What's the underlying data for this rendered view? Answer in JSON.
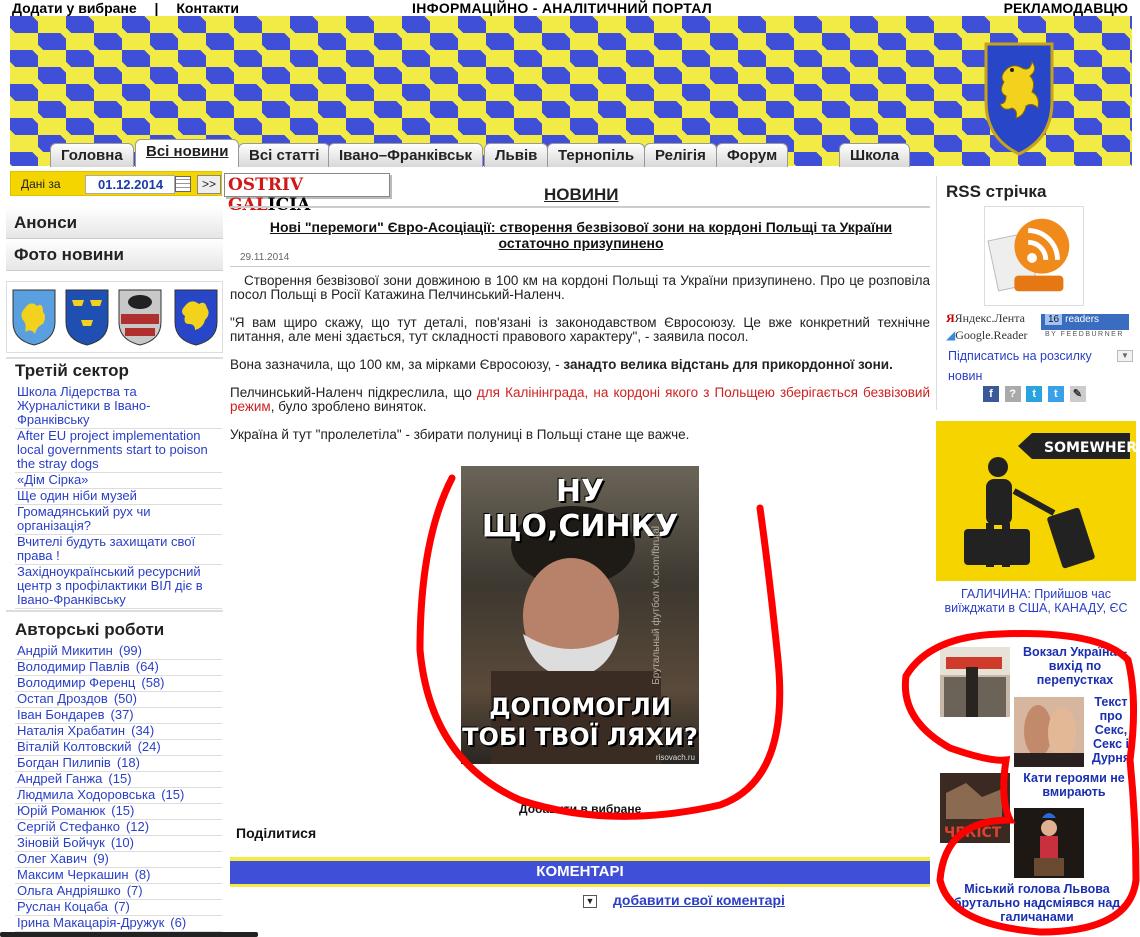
{
  "top": {
    "add_favorites": "Додати у вибране",
    "separator": "|",
    "contacts": "Контакти",
    "portal_title": "ІНФОРМАЦІЙНО - АНАЛІТИЧНИЙ ПОРТАЛ",
    "advertisers": "РЕКЛАМОДАВЦЮ"
  },
  "tabs": [
    {
      "label": "Головна"
    },
    {
      "label": "Всі новини"
    },
    {
      "label": "Всі статті"
    },
    {
      "label": "Івано–Франківськ"
    },
    {
      "label": "Львів"
    },
    {
      "label": "Тернопіль"
    },
    {
      "label": "Релігія"
    },
    {
      "label": "Форум"
    },
    {
      "label": "Школа"
    }
  ],
  "datebar": {
    "label": "Дані за",
    "date": "01.12.2014",
    "go": ">>"
  },
  "left": {
    "announcements": "Анонси",
    "photo_news": "Фото новини",
    "third_sector_title": "Третій сектор",
    "third_sector": [
      "Школа Лідерства та Журналістики в Івано-Франківську",
      "After EU project implementation local governments start to poison the stray dogs",
      "«Дім Сірка»",
      "Ще один ніби музей",
      "Громадянський рух чи організація?",
      "Вчителі будуть захищати свої права !",
      "Західноукраїнський ресурсний центр з профілактики ВІЛ діє в Івано-Франківську"
    ],
    "authors_title": "Авторські роботи",
    "authors": [
      {
        "name": "Андрій Микитин",
        "count": "(99)"
      },
      {
        "name": "Володимир Павлів",
        "count": "(64)"
      },
      {
        "name": "Володимир Ференц",
        "count": "(58)"
      },
      {
        "name": "Остап Дроздов",
        "count": "(50)"
      },
      {
        "name": "Іван Бондарев",
        "count": "(37)"
      },
      {
        "name": "Наталія Храбатин",
        "count": "(34)"
      },
      {
        "name": "Віталій Колтовский",
        "count": "(24)"
      },
      {
        "name": "Богдан Пилипів",
        "count": "(18)"
      },
      {
        "name": "Андрей Ганжа",
        "count": "(15)"
      },
      {
        "name": "Людмила Ходоровська",
        "count": "(15)"
      },
      {
        "name": "Юрій Романюк",
        "count": "(15)"
      },
      {
        "name": "Сергій Стефанко",
        "count": "(12)"
      },
      {
        "name": "Зіновій Бойчук",
        "count": "(10)"
      },
      {
        "name": "Олег Хавич",
        "count": "(9)"
      },
      {
        "name": "Максим Черкашин",
        "count": "(8)"
      },
      {
        "name": "Ольга Андріяшко",
        "count": "(7)"
      },
      {
        "name": "Руслан Коцаба",
        "count": "(7)"
      },
      {
        "name": "Ірина Макацарія-Дружук",
        "count": "(6)"
      }
    ]
  },
  "center": {
    "logo_a": "OSTRIV",
    "logo_b": " GAL",
    "logo_c": "ICIA",
    "news_heading": "НОВИНИ",
    "article_title": "Нові \"перемоги\" Євро-Асоціації: створення безвізової зони на кордоні Польщі та України остаточно призупинено",
    "article_date": "29.11.2014",
    "p1": "Створення безвізової зони довжиною в 100 км на кордоні Польщі та України призупинено. Про це розповіла посол Польщі в Росії Катажина Пелчинський-Наленч.",
    "p2": "\"Я вам щиро скажу, що тут деталі, пов'язані із законодавством Євросоюзу. Це вже конкретний технічне питання, але мені здається, тут складності правового характеру\", - заявила посол.",
    "p3_a": "Вона зазначила, що 100 км, за мірками Євросоюзу, - ",
    "p3_b": "занадто велика відстань для прикордонної зони.",
    "p4_a": "Пелчинський-Наленч підкреслила, що ",
    "p4_b": "для Калінінграда, на кордоні якого з Польщею зберігається безвізовий режим",
    "p4_c": ", було зроблено виняток.",
    "p5": "Україна й тут \"пролелетіла\" - збирати полуниці в Польщі стане ще важче.",
    "meme_top": "НУ ЩО,СИНКУ",
    "meme_bottom_1": "ДОПОМОГЛИ",
    "meme_bottom_2": "ТОБІ ТВОЇ ЛЯХИ?",
    "meme_watermark": "risovach.ru",
    "meme_vertical": "Брутальный футбол vk.com/fbrutal",
    "add_favorites": "Добавити в вибране",
    "share": "Поділитися",
    "comments_heading": "КОМЕНТАРІ",
    "add_comment": "добавити свої коментарі"
  },
  "right": {
    "rss_title": "RSS стрічка",
    "yandex_lenta": "Яндекс.Лента",
    "google_reader": "Google.Reader",
    "readers_count": "16",
    "readers_label": "readers",
    "by_feedburner": "BY FEEDBURNER",
    "subscribe": "Підписатись на розсилку новин",
    "ad_text": "SOMEWHERE",
    "ad_caption": "ГАЛИЧИНА: Прийшов час виїжджати в США, КАНАДУ, ЄС",
    "link1": "Вокзал Україна – вихід по перепустках",
    "link2": "Текст про Секс, Секс і Дурня",
    "link3": "Кати героями не вмирають",
    "thumb3_label": "ЧЕКІСТ",
    "link4": "Міський голова Львова брутально надсміявся над галичанами"
  },
  "colors": {
    "flag_blue": "#3f4fd8",
    "flag_yellow": "#f2ea45",
    "link_blue": "#2a3fc6",
    "highlight_red": "#d02020",
    "annotation_red": "#ff0000"
  }
}
